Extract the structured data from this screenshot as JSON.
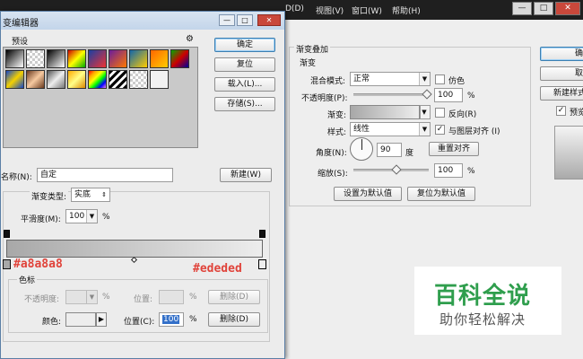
{
  "app": {
    "menus": [
      {
        "label": "D(D)"
      },
      {
        "label": "视图(V)"
      },
      {
        "label": "窗口(W)"
      },
      {
        "label": "帮助(H)"
      }
    ],
    "window_controls": [
      "—",
      "□",
      "✕"
    ]
  },
  "gradient_editor": {
    "title": "变编辑器",
    "presets_label": "预设",
    "gear_icon": "gear-icon",
    "buttons": {
      "ok": "确定",
      "reset": "复位",
      "load": "载入(L)...",
      "save": "存储(S)...",
      "new": "新建(W)"
    },
    "name_label": "名称(N):",
    "name_value": "自定",
    "gradient_type_label": "渐变类型:",
    "gradient_type_value": "实底",
    "smoothness_label": "平滑度(M):",
    "smoothness_value": "100",
    "percent": "%",
    "left_color_annotation": "#a8a8a8",
    "right_color_annotation": "#ededed",
    "stops_group_label": "色标",
    "opacity_label": "不透明度:",
    "opacity_location_label": "位置:",
    "opacity_delete": "删除(D)",
    "color_label": "颜色:",
    "color_location_label": "位置(C):",
    "color_location_value": "100",
    "color_delete": "删除(D)",
    "stop_colors": {
      "left": "#a8a8a8",
      "right": "#ededed"
    }
  },
  "layer_style": {
    "section_title": "渐变叠加",
    "group_label": "渐变",
    "blend_mode_label": "混合模式:",
    "blend_mode_value": "正常",
    "dither_label": "仿色",
    "opacity_label": "不透明度(P):",
    "opacity_value": "100",
    "gradient_label": "渐变:",
    "reverse_label": "反向(R)",
    "style_label": "样式:",
    "style_value": "线性",
    "align_label": "与图层对齐 (I)",
    "angle_label": "角度(N):",
    "angle_value": "90",
    "degree_unit": "度",
    "reset_align_button": "重置对齐",
    "scale_label": "缩放(S):",
    "scale_value": "100",
    "percent": "%",
    "set_default_button": "设置为默认值",
    "reset_default_button": "复位为默认值",
    "right_buttons": {
      "ok": "确",
      "cancel": "取",
      "new_style": "新建样式",
      "preview": "预览"
    },
    "dither_checked": false,
    "reverse_checked": false,
    "align_checked": true,
    "preview_checked": true
  },
  "watermark": {
    "main": "百科全说",
    "sub": "助你轻松解决"
  }
}
